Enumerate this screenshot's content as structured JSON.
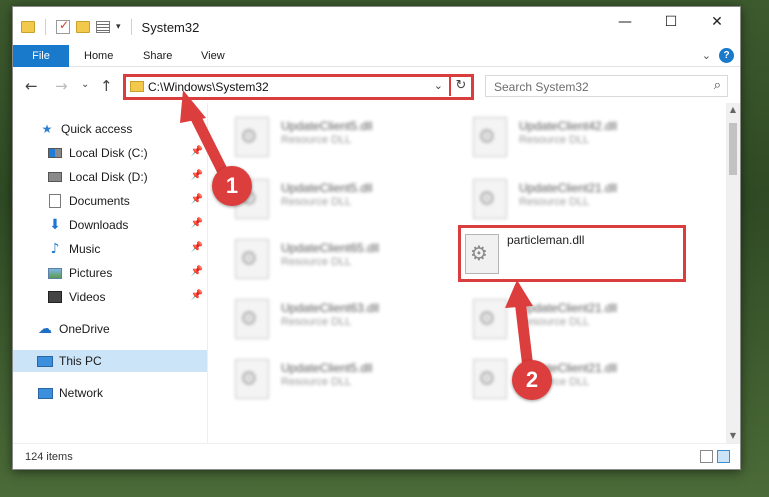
{
  "window": {
    "title": "System32",
    "minimize_glyph": "—",
    "maximize_glyph": "☐",
    "close_glyph": "✕"
  },
  "quick_access_toolbar": {
    "dropdown_glyph": "▾"
  },
  "ribbon": {
    "tabs": [
      "File",
      "Home",
      "Share",
      "View"
    ],
    "collapse_glyph": "⌄",
    "help_glyph": "?"
  },
  "address_bar": {
    "back_glyph": "←",
    "forward_glyph": "→",
    "recent_glyph": "⌄",
    "up_glyph": "↑",
    "path": "C:\\Windows\\System32",
    "dropdown_glyph": "⌄",
    "refresh_glyph": "↻"
  },
  "search": {
    "placeholder": "Search System32",
    "icon_glyph": "⌕"
  },
  "sidebar": {
    "pin_glyph": "📌",
    "items": [
      {
        "label": "Quick access",
        "icon": "star-icon",
        "glyph": "★",
        "pinned": false
      },
      {
        "label": "Local Disk (C:)",
        "icon": "drive-icon",
        "pinned": true
      },
      {
        "label": "Local Disk (D:)",
        "icon": "drive-icon",
        "pinned": true
      },
      {
        "label": "Documents",
        "icon": "document-icon",
        "pinned": true
      },
      {
        "label": "Downloads",
        "icon": "download-icon",
        "glyph": "⬇",
        "pinned": true
      },
      {
        "label": "Music",
        "icon": "music-icon",
        "glyph": "♪",
        "pinned": true
      },
      {
        "label": "Pictures",
        "icon": "picture-icon",
        "pinned": true
      },
      {
        "label": "Videos",
        "icon": "video-icon",
        "pinned": true
      },
      {
        "label": "OneDrive",
        "icon": "cloud-icon",
        "glyph": "☁",
        "pinned": false
      },
      {
        "label": "This PC",
        "icon": "computer-icon",
        "pinned": false,
        "selected": true
      },
      {
        "label": "Network",
        "icon": "network-icon",
        "pinned": false
      }
    ]
  },
  "files": {
    "blurred": [
      {
        "name": "UpdateClient5.dll",
        "type": "Resource DLL"
      },
      {
        "name": "UpdateClient42.dll",
        "type": "Resource DLL"
      },
      {
        "name": "UpdateClient5.dll",
        "type": "Resource DLL"
      },
      {
        "name": "UpdateClient21.dll",
        "type": "Resource DLL"
      },
      {
        "name": "UpdateClient65.dll",
        "type": "Resource DLL"
      },
      {
        "name": "UpdateClient63.dll",
        "type": "Resource DLL"
      },
      {
        "name": "UpdateClient21.dll",
        "type": "Resource DLL"
      },
      {
        "name": "UpdateClient5.dll",
        "type": "Resource DLL"
      },
      {
        "name": "UpdateClient21.dll",
        "type": "Resource DLL"
      }
    ],
    "target": {
      "name": "particleman.dll"
    }
  },
  "scrollbar": {
    "up_glyph": "▲",
    "down_glyph": "▼"
  },
  "status": {
    "item_count": "124 items"
  },
  "annotations": {
    "step1": "1",
    "step2": "2",
    "highlight_color": "#d93d3d",
    "badge_color": "#dc3d3d"
  },
  "colors": {
    "accent": "#1979ca",
    "selection": "#cce4f7"
  }
}
